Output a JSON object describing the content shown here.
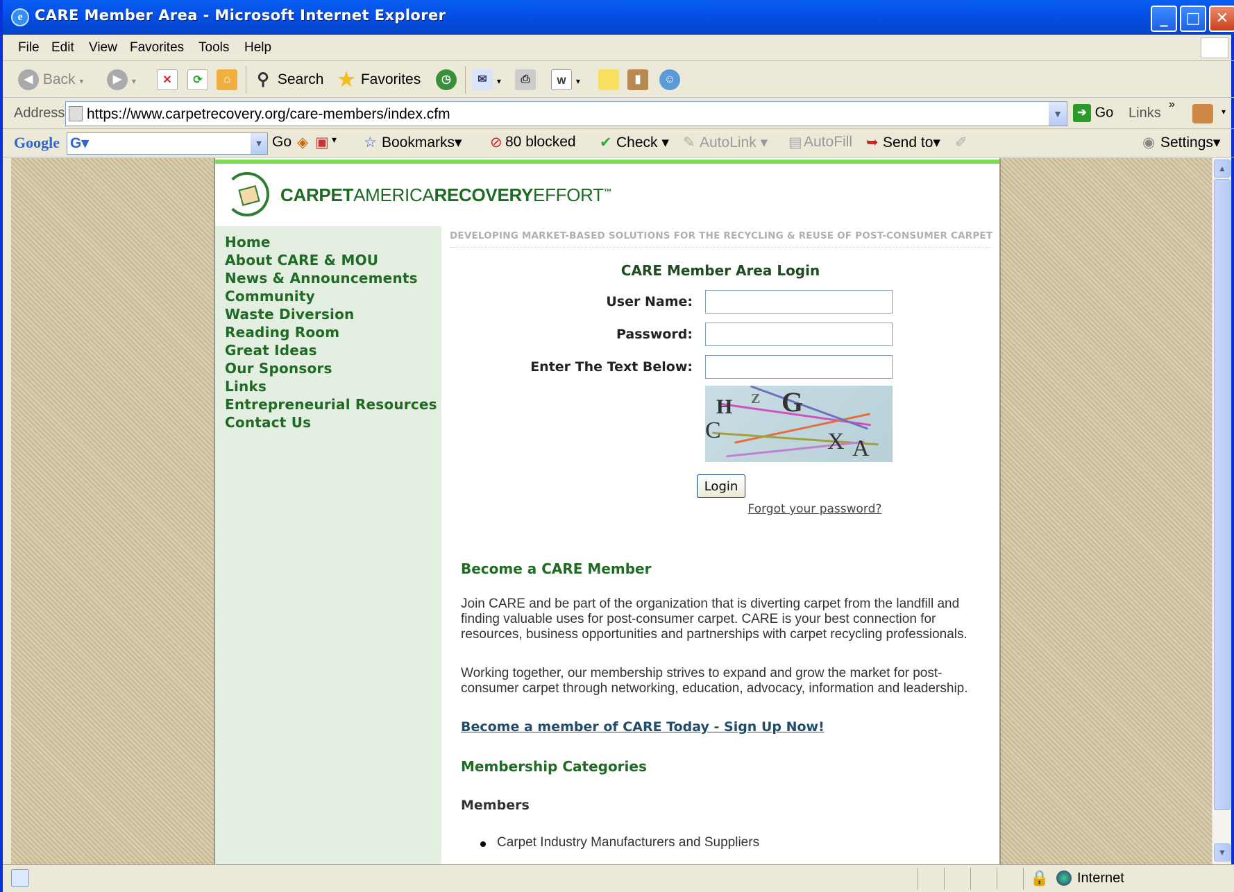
{
  "window": {
    "title": "CARE Member Area - Microsoft Internet Explorer"
  },
  "menu": [
    "File",
    "Edit",
    "View",
    "Favorites",
    "Tools",
    "Help"
  ],
  "toolbar": {
    "back": "Back",
    "search": "Search",
    "favorites": "Favorites"
  },
  "address": {
    "label": "Address",
    "url": "https://www.carpetrecovery.org/care-members/index.cfm",
    "go": "Go",
    "links": "Links"
  },
  "google": {
    "logo": "Google",
    "go": "Go",
    "bookmarks": "Bookmarks",
    "blocked": "80 blocked",
    "check": "Check",
    "autolink": "AutoLink",
    "autofill": "AutoFill",
    "sendto": "Send to",
    "settings": "Settings"
  },
  "site": {
    "logo_bold1": "CARPET",
    "logo_light1": "AMERICA",
    "logo_bold2": "RECOVERY",
    "logo_light2": "EFFORT",
    "tm": "™",
    "tagline": "DEVELOPING MARKET-BASED SOLUTIONS FOR THE RECYCLING & REUSE OF POST-CONSUMER CARPET",
    "nav": [
      "Home",
      "About CARE & MOU",
      "News & Announcements",
      "Community",
      "Waste Diversion",
      "Reading Room",
      "Great Ideas",
      "Our Sponsors",
      "Links",
      "Entrepreneurial Resources",
      "Contact Us"
    ]
  },
  "login": {
    "title": "CARE Member Area Login",
    "username_label": "User Name:",
    "password_label": "Password:",
    "captcha_label": "Enter The Text Below:",
    "captcha_letters": [
      "H",
      "Z",
      "G",
      "C",
      "X",
      "A"
    ],
    "button": "Login",
    "forgot": "Forgot your password?"
  },
  "content": {
    "become_heading": "Become a CARE Member",
    "para1": "Join CARE and be part of the organization that is diverting carpet from the landfill and finding valuable uses for post-consumer carpet. CARE is your best connection for resources, business opportunities and partnerships with carpet recycling professionals.",
    "para2": "Working together, our membership strives to expand and grow the market for post-consumer carpet through networking, education, advocacy, information and leadership.",
    "signup_link": "Become a member of CARE Today - Sign Up Now!",
    "categories_heading": "Membership Categories",
    "members_heading": "Members",
    "members_list": [
      "Carpet Industry Manufacturers and Suppliers"
    ]
  },
  "status": {
    "zone": "Internet"
  }
}
